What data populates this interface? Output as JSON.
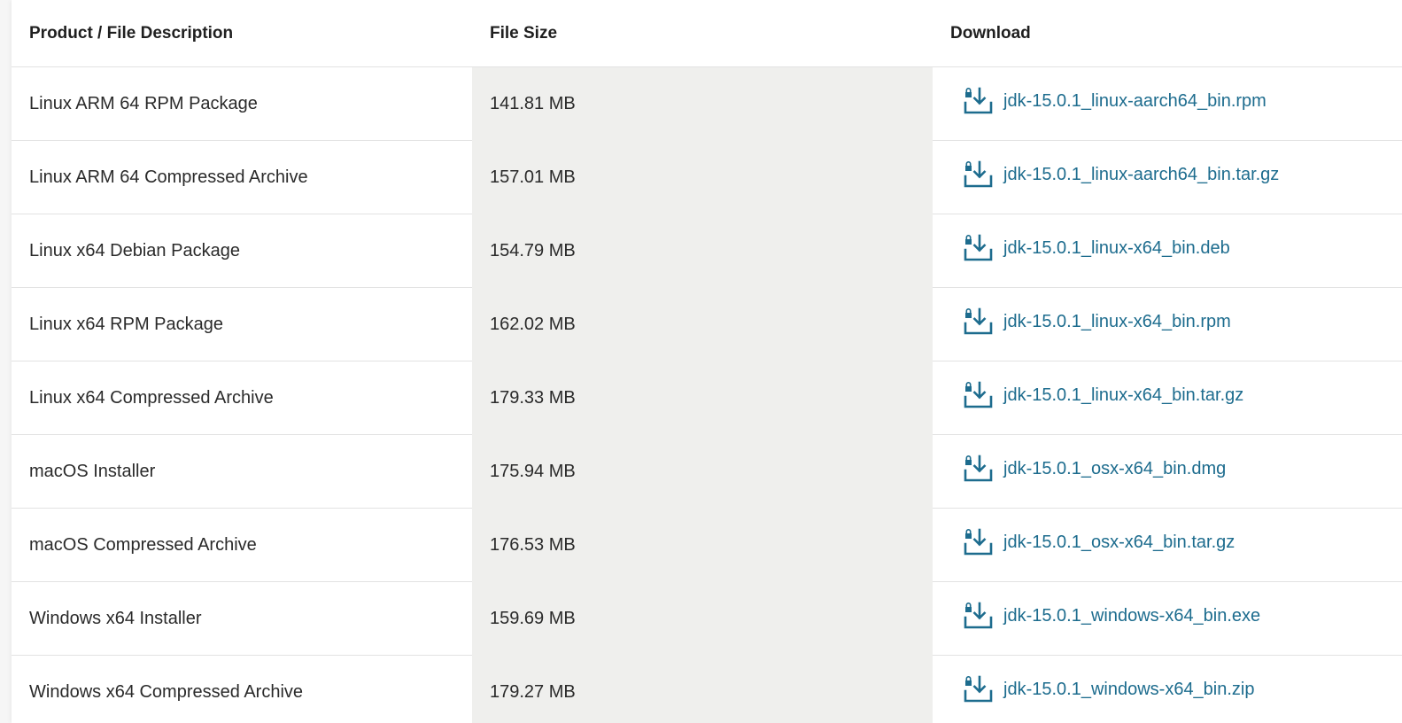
{
  "columns": {
    "description": "Product / File Description",
    "size": "File Size",
    "download": "Download"
  },
  "icons": {
    "download": "download-lock-icon"
  },
  "colors": {
    "link": "#1d6c8e",
    "size_column_bg": "#efefed"
  },
  "rows": [
    {
      "description": "Linux ARM 64 RPM Package",
      "size": "141.81 MB",
      "file": "jdk-15.0.1_linux-aarch64_bin.rpm"
    },
    {
      "description": "Linux ARM 64 Compressed Archive",
      "size": "157.01 MB",
      "file": "jdk-15.0.1_linux-aarch64_bin.tar.gz"
    },
    {
      "description": "Linux x64 Debian Package",
      "size": "154.79 MB",
      "file": "jdk-15.0.1_linux-x64_bin.deb"
    },
    {
      "description": "Linux x64 RPM Package",
      "size": "162.02 MB",
      "file": "jdk-15.0.1_linux-x64_bin.rpm"
    },
    {
      "description": "Linux x64 Compressed Archive",
      "size": "179.33 MB",
      "file": "jdk-15.0.1_linux-x64_bin.tar.gz"
    },
    {
      "description": "macOS Installer",
      "size": "175.94 MB",
      "file": "jdk-15.0.1_osx-x64_bin.dmg"
    },
    {
      "description": "macOS Compressed Archive",
      "size": "176.53 MB",
      "file": "jdk-15.0.1_osx-x64_bin.tar.gz"
    },
    {
      "description": "Windows x64 Installer",
      "size": "159.69 MB",
      "file": "jdk-15.0.1_windows-x64_bin.exe"
    },
    {
      "description": "Windows x64 Compressed Archive",
      "size": "179.27 MB",
      "file": "jdk-15.0.1_windows-x64_bin.zip"
    }
  ]
}
